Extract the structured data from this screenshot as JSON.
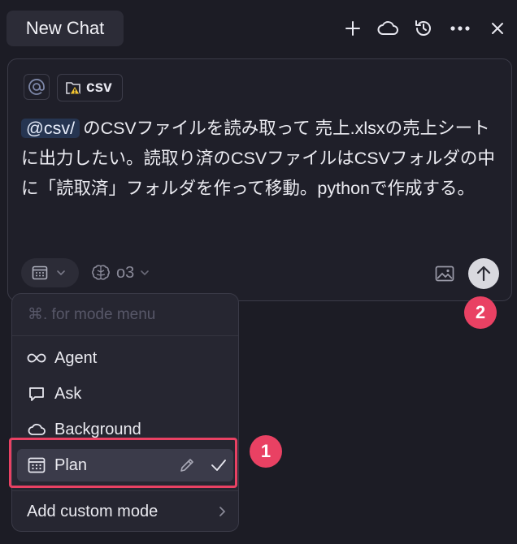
{
  "header": {
    "tab_title": "New Chat",
    "icons": [
      "plus-icon",
      "cloud-icon",
      "history-icon",
      "more-icon",
      "close-icon"
    ]
  },
  "composer": {
    "context_chip_label": "csv",
    "mention": "@csv/",
    "message_text": "のCSVファイルを読み取って 売上.xlsxの売上シートに出力したい。読取り済のCSVファイルはCSVフォルダの中に「読取済」フォルダを作って移動。pythonで作成する。",
    "model_label": "o3"
  },
  "mode_menu": {
    "hint": "⌘. for mode menu",
    "items": [
      {
        "label": "Agent",
        "icon": "infinity-icon"
      },
      {
        "label": "Ask",
        "icon": "chat-bubble-icon"
      },
      {
        "label": "Background",
        "icon": "cloud-icon"
      },
      {
        "label": "Plan",
        "icon": "plan-icon",
        "selected": true
      }
    ],
    "add_custom_label": "Add custom mode"
  },
  "annotations": {
    "badge_1": "1",
    "badge_2": "2",
    "highlight_color": "#e94163"
  },
  "colors": {
    "background": "#1c1c25",
    "mention_bg": "#263551",
    "send_button": "#d9d9df"
  }
}
